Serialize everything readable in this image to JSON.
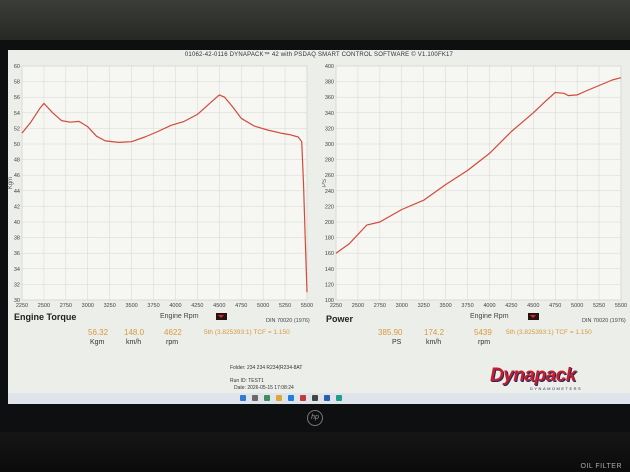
{
  "header": "01062-42-0116 DYNAPACK™ 42 with PSDAQ SMART CONTROL SOFTWARE © V1.100FK17",
  "torque": {
    "title": "Engine Torque",
    "din": "DIN 70020 (1976)",
    "rpm_label": "Engine Rpm",
    "ylabel": "Kgm",
    "yticks": [
      "60",
      "58",
      "56",
      "54",
      "52",
      "50",
      "48",
      "46",
      "44",
      "42",
      "40",
      "38",
      "36",
      "34",
      "32",
      "30"
    ],
    "xticks": [
      "2250",
      "2500",
      "2750",
      "3000",
      "3250",
      "3500",
      "3750",
      "4000",
      "4250",
      "4500",
      "4750",
      "5000",
      "5250",
      "5500"
    ],
    "value": "56.32",
    "value_unit": "Kgm",
    "speed": "148.0",
    "speed_unit": "km/h",
    "rpm": "4622",
    "rpm_unit": "rpm",
    "gear": "5th (3.825393:1) TCF = 1.150"
  },
  "power": {
    "title": "Power",
    "din": "DIN 70020 (1976)",
    "rpm_label": "Engine Rpm",
    "ylabel": "PS",
    "yticks": [
      "400",
      "380",
      "360",
      "340",
      "320",
      "300",
      "280",
      "260",
      "240",
      "220",
      "200",
      "180",
      "160",
      "140",
      "120",
      "100"
    ],
    "xticks": [
      "2250",
      "2500",
      "2750",
      "3000",
      "3250",
      "3500",
      "3750",
      "4000",
      "4250",
      "4500",
      "4750",
      "5000",
      "5250",
      "5500"
    ],
    "value": "385.90",
    "value_unit": "PS",
    "speed": "174.2",
    "speed_unit": "km/h",
    "rpm": "5439",
    "rpm_unit": "rpm",
    "gear": "5th (3.825393:1) TCF = 1.150"
  },
  "meta": {
    "folder": "Folder:  234 234 R234(R234-8AT",
    "run_id": "Run ID:  TEST1",
    "date": "Date:  2026-05-15 17:08:24"
  },
  "logo": {
    "name": "Dynapack",
    "tagline": "DYNAMOMETERS"
  },
  "desk_label": "OIL FILTER",
  "line_color": "#d24a3c",
  "chart_data": [
    {
      "type": "line",
      "title": "Engine Torque",
      "xlabel": "Engine Rpm",
      "ylabel": "Kgm",
      "xlim": [
        2250,
        5500
      ],
      "ylim": [
        30,
        60
      ],
      "x": [
        2250,
        2350,
        2450,
        2500,
        2600,
        2700,
        2800,
        2900,
        3000,
        3100,
        3200,
        3350,
        3500,
        3650,
        3800,
        3950,
        4100,
        4250,
        4400,
        4500,
        4560,
        4650,
        4750,
        4900,
        5050,
        5200,
        5300,
        5400,
        5440,
        5460,
        5480,
        5500
      ],
      "y": [
        51.4,
        52.8,
        54.5,
        55.2,
        54.0,
        53.0,
        52.8,
        52.9,
        52.2,
        51.0,
        50.4,
        50.2,
        50.3,
        50.9,
        51.6,
        52.4,
        52.9,
        53.8,
        55.3,
        56.3,
        56.0,
        54.8,
        53.3,
        52.3,
        51.8,
        51.4,
        51.2,
        50.9,
        50.3,
        45.0,
        38.0,
        31.0
      ]
    },
    {
      "type": "line",
      "title": "Power",
      "xlabel": "Engine Rpm",
      "ylabel": "PS",
      "xlim": [
        2250,
        5500
      ],
      "ylim": [
        100,
        400
      ],
      "x": [
        2250,
        2400,
        2600,
        2750,
        3000,
        3250,
        3500,
        3750,
        4000,
        4250,
        4500,
        4650,
        4750,
        4850,
        4900,
        5000,
        5100,
        5250,
        5400,
        5500
      ],
      "y": [
        160,
        172,
        196,
        200,
        216,
        228,
        248,
        266,
        288,
        316,
        340,
        356,
        366,
        365,
        362,
        363,
        368,
        375,
        382,
        385
      ]
    }
  ]
}
